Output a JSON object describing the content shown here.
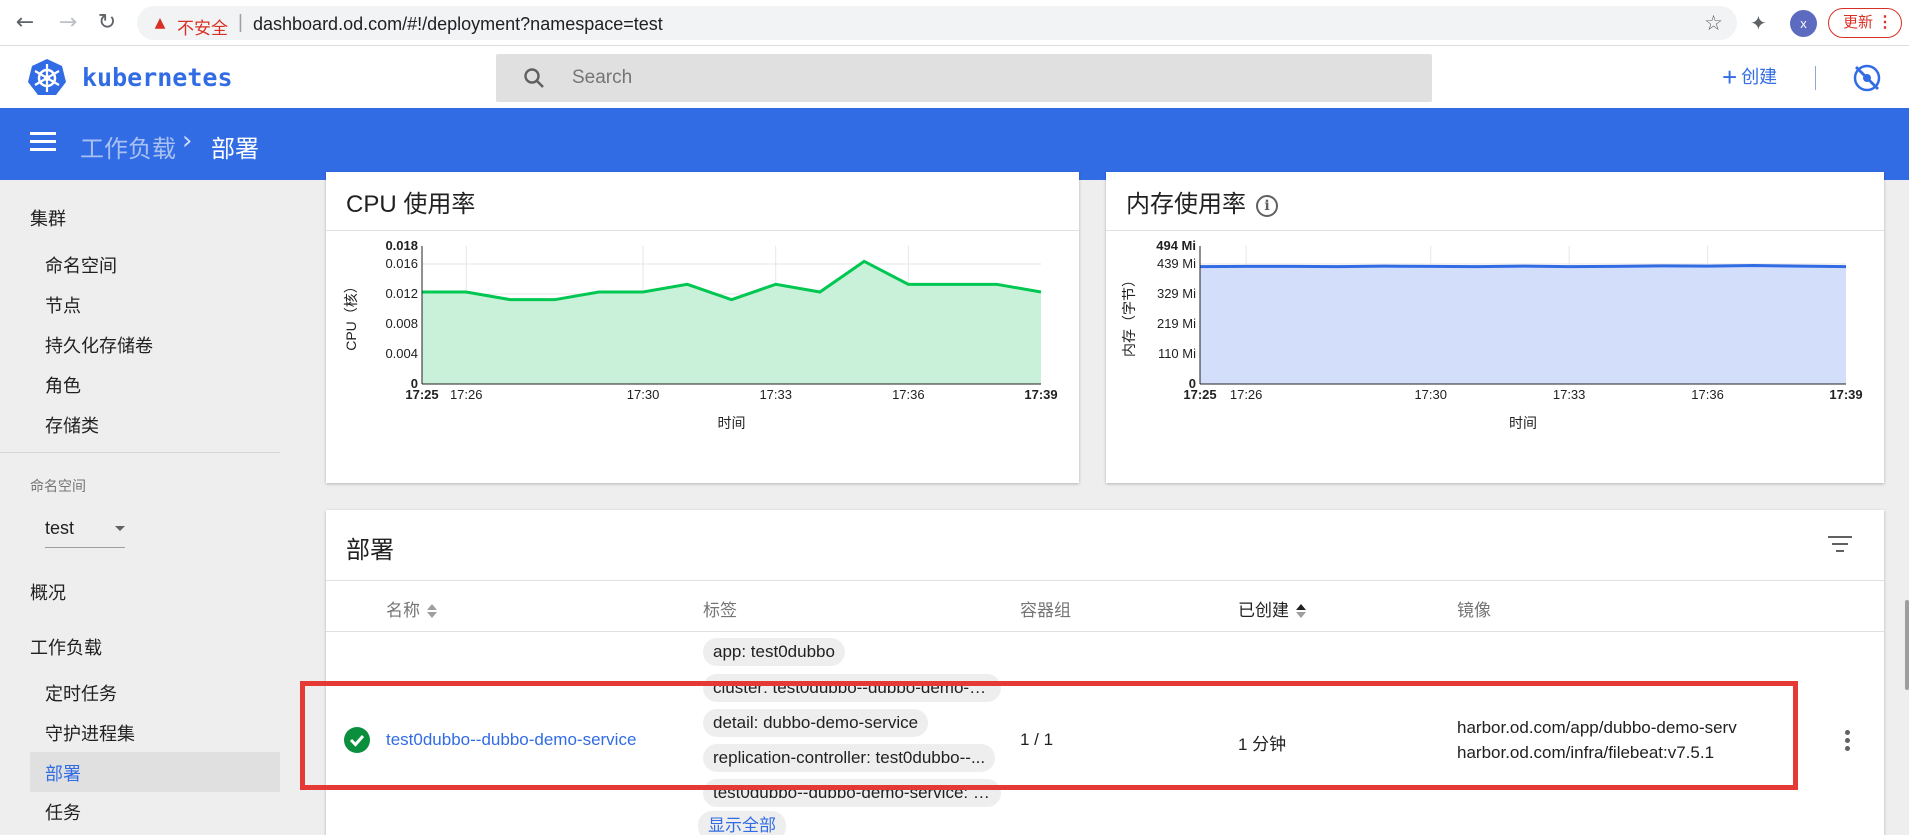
{
  "browser": {
    "back_icon": "arrow-left-icon",
    "security_label": "不安全",
    "url": "dashboard.od.com/#!/deployment?namespace=test",
    "profile_initial": "x",
    "update_label": "更新"
  },
  "header": {
    "brand": "kubernetes",
    "search_placeholder": "Search",
    "create_label": "创建"
  },
  "toolbar": {
    "breadcrumb_parent": "工作负载",
    "breadcrumb_current": "部署"
  },
  "sidebar": {
    "cluster_heading": "集群",
    "cluster_items": [
      "命名空间",
      "节点",
      "持久化存储卷",
      "角色",
      "存储类"
    ],
    "namespace_label": "命名空间",
    "namespace_value": "test",
    "overview": "概况",
    "workloads_heading": "工作负载",
    "workload_items": [
      "定时任务",
      "守护进程集",
      "部署",
      "任务"
    ],
    "active_item": "部署"
  },
  "cpu_card": {
    "title": "CPU 使用率"
  },
  "memory_card": {
    "title": "内存使用率"
  },
  "chart_data": [
    {
      "type": "area",
      "ylabel": "CPU（核）",
      "xlabel": "时间",
      "ylim": [
        0,
        0.018
      ],
      "yticks": [
        "0",
        "0.004",
        "0.008",
        "0.012",
        "0.016",
        "0.018"
      ],
      "xticks": [
        "17:25",
        "17:26",
        "17:30",
        "17:33",
        "17:36",
        "17:39"
      ],
      "values": [
        0.012,
        0.012,
        0.011,
        0.011,
        0.012,
        0.012,
        0.013,
        0.011,
        0.013,
        0.012,
        0.016,
        0.013,
        0.013,
        0.013,
        0.012
      ],
      "color": "#00c752",
      "fill": "#c9f1d9"
    },
    {
      "type": "area",
      "ylabel": "内存（字节）",
      "xlabel": "时间",
      "ylim": [
        0,
        494
      ],
      "yticks": [
        "0",
        "110 Mi",
        "219 Mi",
        "329 Mi",
        "439 Mi",
        "494 Mi"
      ],
      "xticks": [
        "17:25",
        "17:26",
        "17:30",
        "17:33",
        "17:36",
        "17:39"
      ],
      "values": [
        420,
        421,
        421,
        420,
        422,
        421,
        420,
        422,
        420,
        421,
        423,
        422,
        424,
        422,
        420
      ],
      "color": "#326ce5",
      "fill": "#d3defa"
    }
  ],
  "deployments": {
    "title": "部署",
    "columns": [
      "名称",
      "标签",
      "容器组",
      "已创建",
      "镜像"
    ],
    "row": {
      "name": "test0dubbo--dubbo-demo-service",
      "labels": [
        "app: test0dubbo",
        "cluster: test0dubbo--dubbo-demo-s...",
        "detail: dubbo-demo-service",
        "replication-controller: test0dubbo--...",
        "test0dubbo--dubbo-demo-service: t..."
      ],
      "show_all": "显示全部",
      "pods": "1 / 1",
      "created": "1 分钟",
      "images": [
        "harbor.od.com/app/dubbo-demo-serv",
        "harbor.od.com/infra/filebeat:v7.5.1"
      ]
    }
  }
}
